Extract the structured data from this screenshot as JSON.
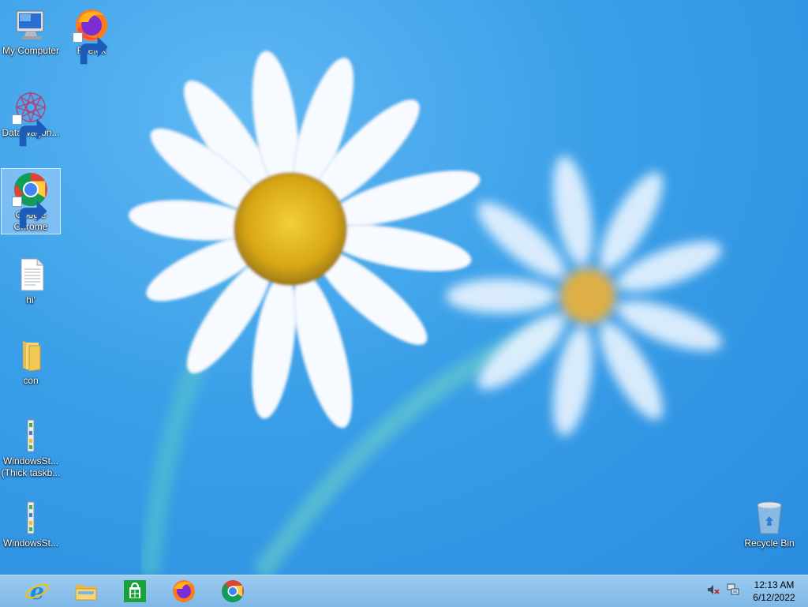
{
  "desktop": {
    "icons": [
      {
        "id": "my-computer",
        "label": "My Computer"
      },
      {
        "id": "firefox",
        "label": "Firefox"
      },
      {
        "id": "datawagon",
        "label": "DataWagon..."
      },
      {
        "id": "google-chrome",
        "label": "Google\nChrome"
      },
      {
        "id": "hi",
        "label": "hi'"
      },
      {
        "id": "con",
        "label": "con"
      },
      {
        "id": "windowsst-thick",
        "label": "WindowsSt...\n(Thick taskb..."
      },
      {
        "id": "windowsst",
        "label": "WindowsSt..."
      },
      {
        "id": "recycle-bin",
        "label": "Recycle Bin"
      }
    ],
    "selected_icon": "google-chrome"
  },
  "taskbar": {
    "pinned": [
      {
        "icon": "internet-explorer-icon"
      },
      {
        "icon": "file-explorer-icon"
      },
      {
        "icon": "store-icon"
      },
      {
        "icon": "firefox-icon"
      },
      {
        "icon": "chrome-icon"
      }
    ],
    "tray": [
      {
        "icon": "volume-muted-icon"
      },
      {
        "icon": "network-icon"
      }
    ],
    "clock": {
      "time": "12:13 AM",
      "date": "6/12/2022"
    }
  },
  "colors": {
    "wallpaper_blue": "#3a9fe8",
    "taskbar": "#8cc2ea",
    "flower_center": "#e0b51c"
  }
}
